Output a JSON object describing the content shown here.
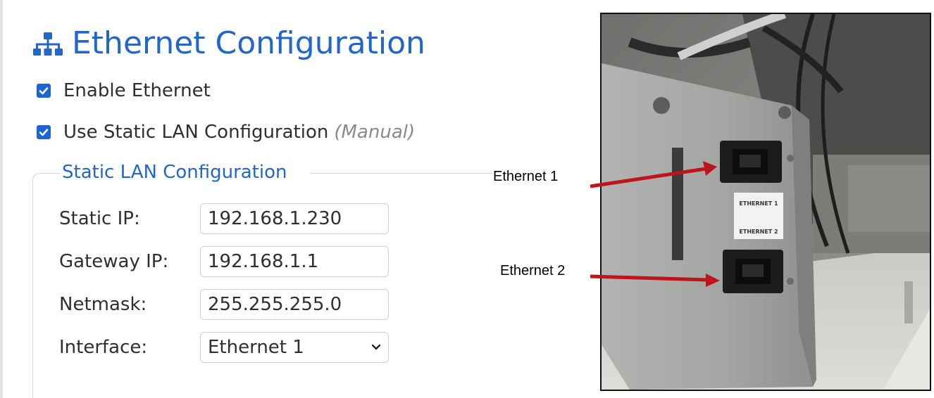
{
  "header": {
    "title": "Ethernet Configuration",
    "icon": "network-icon"
  },
  "options": {
    "enable_ethernet": {
      "label": "Enable Ethernet",
      "checked": true
    },
    "static_lan": {
      "label": "Use Static LAN Configuration",
      "note": "(Manual)",
      "checked": true
    }
  },
  "static_lan": {
    "legend": "Static LAN Configuration",
    "fields": [
      {
        "label": "Static IP:",
        "value": "192.168.1.230"
      },
      {
        "label": "Gateway IP:",
        "value": "192.168.1.1"
      },
      {
        "label": "Netmask:",
        "value": "255.255.255.0"
      }
    ],
    "interface": {
      "label": "Interface:",
      "value": "Ethernet 1"
    }
  },
  "photo": {
    "callouts": {
      "port1": "Ethernet 1",
      "port2": "Ethernet 2"
    },
    "port_labels": {
      "port1": "ETHERNET 1",
      "port2": "ETHERNET 2"
    }
  },
  "colors": {
    "accent": "#2266c9",
    "checkbox": "#1a64d6",
    "arrow": "#c0141c"
  }
}
